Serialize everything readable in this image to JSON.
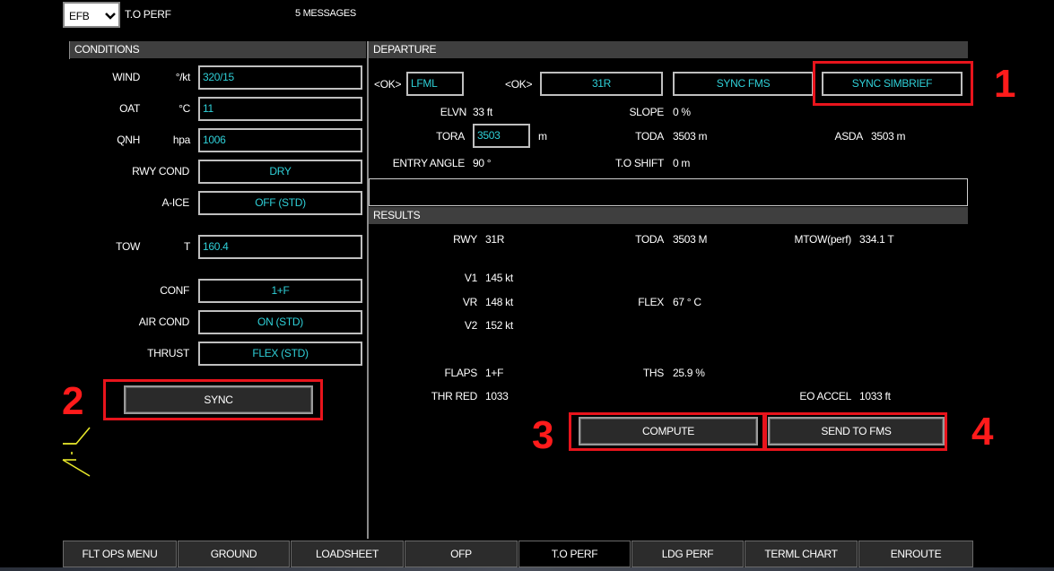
{
  "topbar": {
    "selector_value": "EFB",
    "title": "T.O PERF",
    "messages": "5 MESSAGES"
  },
  "conditions": {
    "header": "CONDITIONS",
    "wind": {
      "label": "WIND",
      "unit": "°/kt",
      "value": "320/15"
    },
    "oat": {
      "label": "OAT",
      "unit": "°C",
      "value": "11"
    },
    "qnh": {
      "label": "QNH",
      "unit": "hpa",
      "value": "1006"
    },
    "rwy_cond": {
      "label": "RWY COND",
      "value": "DRY"
    },
    "a_ice": {
      "label": "A-ICE",
      "value": "OFF (STD)"
    },
    "tow": {
      "label": "TOW",
      "unit": "T",
      "value": "160.4"
    },
    "conf": {
      "label": "CONF",
      "value": "1+F"
    },
    "air_cond": {
      "label": "AIR COND",
      "value": "ON (STD)"
    },
    "thrust": {
      "label": "THRUST",
      "value": "FLEX (STD)"
    },
    "sync_label": "SYNC"
  },
  "departure": {
    "header": "DEPARTURE",
    "ok1": "<OK>",
    "airport": "LFML",
    "ok2": "<OK>",
    "runway": "31R",
    "sync_fms": "SYNC FMS",
    "sync_simbrief": "SYNC SIMBRIEF",
    "elvn": {
      "label": "ELVN",
      "value": "33 ft"
    },
    "slope": {
      "label": "SLOPE",
      "value": "0 %"
    },
    "tora": {
      "label": "TORA",
      "value": "3503",
      "unit": "m"
    },
    "toda": {
      "label": "TODA",
      "value": "3503 m"
    },
    "asda": {
      "label": "ASDA",
      "value": "3503 m"
    },
    "entry_angle": {
      "label": "ENTRY ANGLE",
      "value": "90 °"
    },
    "to_shift": {
      "label": "T.O SHIFT",
      "value": "0 m"
    },
    "message": ""
  },
  "results": {
    "header": "RESULTS",
    "rwy": {
      "label": "RWY",
      "value": "31R"
    },
    "toda": {
      "label": "TODA",
      "value": "3503 M"
    },
    "mtow": {
      "label": "MTOW(perf)",
      "value": "334.1 T"
    },
    "v1": {
      "label": "V1",
      "value": "145 kt"
    },
    "vr": {
      "label": "VR",
      "value": "148 kt"
    },
    "v2": {
      "label": "V2",
      "value": "152 kt"
    },
    "flex": {
      "label": "FLEX",
      "value": "67 ° C"
    },
    "flaps": {
      "label": "FLAPS",
      "value": "1+F"
    },
    "ths": {
      "label": "THS",
      "value": "25.9 %"
    },
    "thr_red": {
      "label": "THR RED",
      "value": "1033"
    },
    "eo_accel": {
      "label": "EO ACCEL",
      "value": "1033 ft"
    },
    "compute": "COMPUTE",
    "send_to_fms": "SEND TO FMS"
  },
  "callouts": [
    "1",
    "2",
    "3",
    "4"
  ],
  "bottom_tabs": [
    "FLT OPS MENU",
    "GROUND",
    "LOADSHEET",
    "OFP",
    "T.O PERF",
    "LDG PERF",
    "TERML CHART",
    "ENROUTE"
  ],
  "active_tab": "T.O PERF",
  "colors": {
    "value_cyan": "#2fd0d8",
    "value_green": "#2ed52e",
    "header_bg": "#3f3f3f",
    "callout_red": "#e8141c"
  }
}
